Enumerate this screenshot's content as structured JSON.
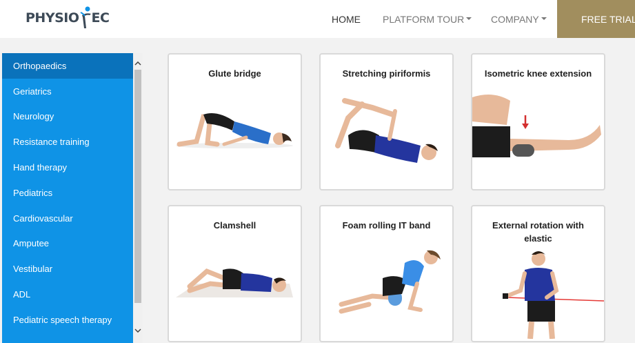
{
  "header": {
    "logo_left": "PHYSIO",
    "logo_right": "EC",
    "nav": {
      "home": "HOME",
      "platform_tour": "PLATFORM TOUR",
      "company": "COMPANY",
      "free_trial": "FREE TRIAL"
    }
  },
  "sidebar": {
    "items": [
      {
        "label": "Orthopaedics",
        "active": true
      },
      {
        "label": "Geriatrics"
      },
      {
        "label": "Neurology"
      },
      {
        "label": "Resistance training"
      },
      {
        "label": "Hand therapy"
      },
      {
        "label": "Pediatrics"
      },
      {
        "label": "Cardiovascular"
      },
      {
        "label": "Amputee"
      },
      {
        "label": "Vestibular"
      },
      {
        "label": "ADL"
      },
      {
        "label": "Pediatric speech therapy"
      }
    ]
  },
  "exercises": [
    {
      "title": "Glute bridge"
    },
    {
      "title": "Stretching piriformis"
    },
    {
      "title": "Isometric knee extension"
    },
    {
      "title": "Clamshell"
    },
    {
      "title": "Foam rolling IT band"
    },
    {
      "title": "External rotation with elastic"
    }
  ],
  "colors": {
    "sidebar_bg": "#0f93e6",
    "sidebar_active": "#0a72bb",
    "free_trial_bg": "#a18e5e",
    "shirt_blue": "#2a6fc9",
    "shorts_black": "#1c1c1c",
    "elastic_red": "#e53935"
  }
}
